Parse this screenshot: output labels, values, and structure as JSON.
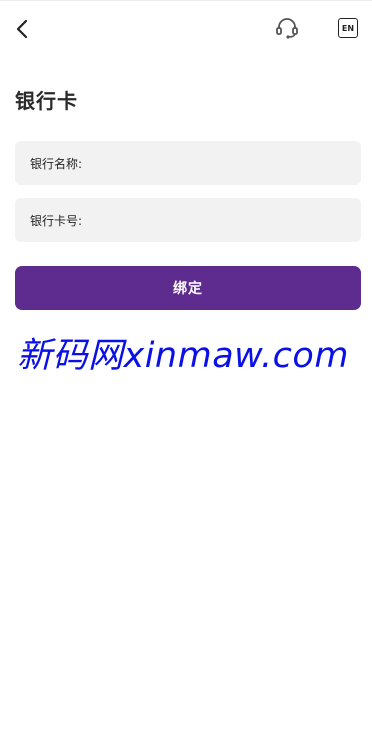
{
  "header": {
    "back_icon": "chevron-left-icon",
    "support_icon": "headset-icon",
    "language_label": "EN"
  },
  "page": {
    "title": "银行卡"
  },
  "form": {
    "bank_name_label": "银行名称:",
    "bank_name_value": "",
    "card_number_label": "银行卡号:",
    "card_number_value": ""
  },
  "actions": {
    "bind_label": "绑定"
  },
  "watermark": {
    "text": "新码网xinmaw.com"
  },
  "colors": {
    "accent": "#5e2b8e",
    "field_bg": "#f2f2f2",
    "watermark": "#0a10e6"
  }
}
